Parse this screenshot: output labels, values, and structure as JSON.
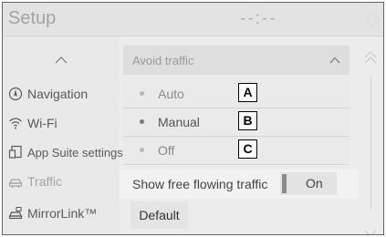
{
  "header": {
    "title": "Setup",
    "clock": "--:--"
  },
  "sidebar": {
    "items": [
      {
        "label": "Navigation",
        "icon": "navigation-icon"
      },
      {
        "label": "Wi-Fi",
        "icon": "wifi-icon"
      },
      {
        "label": "App Suite settings",
        "icon": "app-suite-icon"
      },
      {
        "label": "Traffic",
        "icon": "traffic-icon",
        "active": true
      },
      {
        "label": "MirrorLink™",
        "icon": "mirrorlink-icon"
      }
    ]
  },
  "avoid_traffic": {
    "label": "Avoid traffic",
    "options": [
      {
        "label": "Auto",
        "callout": "A",
        "selected": false
      },
      {
        "label": "Manual",
        "callout": "B",
        "selected": true
      },
      {
        "label": "Off",
        "callout": "C",
        "selected": false
      }
    ]
  },
  "free_flowing": {
    "label": "Show free flowing traffic",
    "toggle_label": "On"
  },
  "default_button": "Default",
  "colors": {
    "background": "#ececec",
    "sidebar_background": "#e9e9e9",
    "text": "#5a5a5a",
    "muted_text": "#a4a4a4"
  }
}
